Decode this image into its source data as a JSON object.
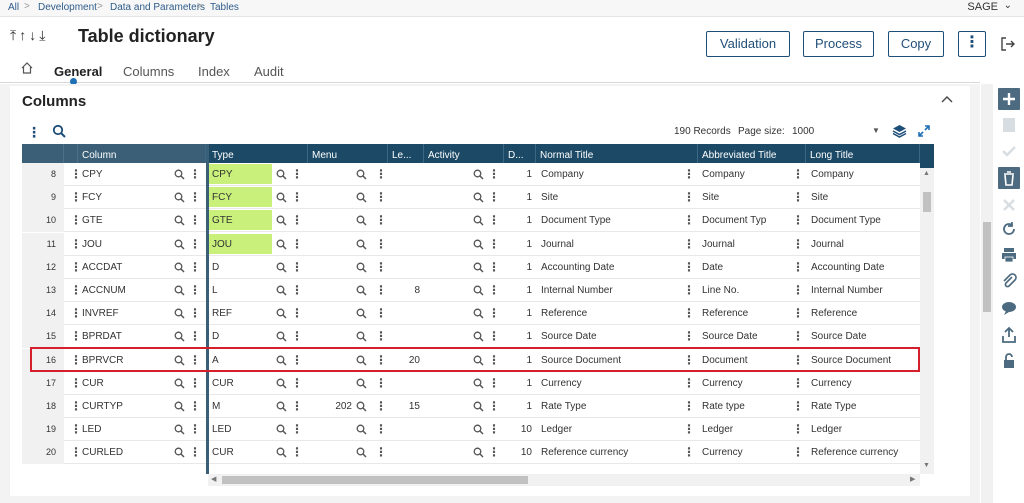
{
  "breadcrumb": [
    "All",
    "Development",
    "Data and Parameters",
    "Tables"
  ],
  "user_menu": "SAGE",
  "page_title": "Table dictionary",
  "actions": {
    "validation": "Validation",
    "process": "Process",
    "copy": "Copy",
    "more": "⋮"
  },
  "tabs": [
    "General",
    "Columns",
    "Index",
    "Audit"
  ],
  "active_tab": "General",
  "section_title": "Columns",
  "records_label": "190 Records",
  "page_size_label": "Page size:",
  "page_size_value": "1000",
  "columns": [
    "Column",
    "Type",
    "Menu",
    "Le...",
    "Activity",
    "D...",
    "Normal Title",
    "Abbreviated Title",
    "Long Title"
  ],
  "rows": [
    {
      "n": "8",
      "col": "CPY",
      "type": "CPY",
      "chip": true,
      "menu": "",
      "len": "",
      "d": "1",
      "normal": "Company",
      "abbr": "Company",
      "long": "Company"
    },
    {
      "n": "9",
      "col": "FCY",
      "type": "FCY",
      "chip": true,
      "menu": "",
      "len": "",
      "d": "1",
      "normal": "Site",
      "abbr": "Site",
      "long": "Site"
    },
    {
      "n": "10",
      "col": "GTE",
      "type": "GTE",
      "chip": true,
      "menu": "",
      "len": "",
      "d": "1",
      "normal": "Document Type",
      "abbr": "Document Typ",
      "long": "Document Type"
    },
    {
      "n": "11",
      "col": "JOU",
      "type": "JOU",
      "chip": true,
      "menu": "",
      "len": "",
      "d": "1",
      "normal": "Journal",
      "abbr": "Journal",
      "long": "Journal"
    },
    {
      "n": "12",
      "col": "ACCDAT",
      "type": "D",
      "chip": false,
      "menu": "",
      "len": "",
      "d": "1",
      "normal": "Accounting Date",
      "abbr": "Date",
      "long": "Accounting Date"
    },
    {
      "n": "13",
      "col": "ACCNUM",
      "type": "L",
      "chip": false,
      "menu": "",
      "len": "8",
      "d": "1",
      "normal": "Internal Number",
      "abbr": "Line No.",
      "long": "Internal Number"
    },
    {
      "n": "14",
      "col": "INVREF",
      "type": "REF",
      "chip": false,
      "menu": "",
      "len": "",
      "d": "1",
      "normal": "Reference",
      "abbr": "Reference",
      "long": "Reference"
    },
    {
      "n": "15",
      "col": "BPRDAT",
      "type": "D",
      "chip": false,
      "menu": "",
      "len": "",
      "d": "1",
      "normal": "Source Date",
      "abbr": "Source Date",
      "long": "Source Date"
    },
    {
      "n": "16",
      "col": "BPRVCR",
      "type": "A",
      "chip": false,
      "menu": "",
      "len": "20",
      "d": "1",
      "normal": "Source Document",
      "abbr": "Document",
      "long": "Source Document"
    },
    {
      "n": "17",
      "col": "CUR",
      "type": "CUR",
      "chip": false,
      "menu": "",
      "len": "",
      "d": "1",
      "normal": "Currency",
      "abbr": "Currency",
      "long": "Currency"
    },
    {
      "n": "18",
      "col": "CURTYP",
      "type": "M",
      "chip": false,
      "menu": "202",
      "len": "15",
      "d": "1",
      "normal": "Rate Type",
      "abbr": "Rate type",
      "long": "Rate Type"
    },
    {
      "n": "19",
      "col": "LED",
      "type": "LED",
      "chip": false,
      "menu": "",
      "len": "",
      "d": "10",
      "normal": "Ledger",
      "abbr": "Ledger",
      "long": "Ledger"
    },
    {
      "n": "20",
      "col": "CURLED",
      "type": "CUR",
      "chip": false,
      "menu": "",
      "len": "",
      "d": "10",
      "normal": "Reference currency",
      "abbr": "Currency",
      "long": "Reference currency"
    }
  ]
}
